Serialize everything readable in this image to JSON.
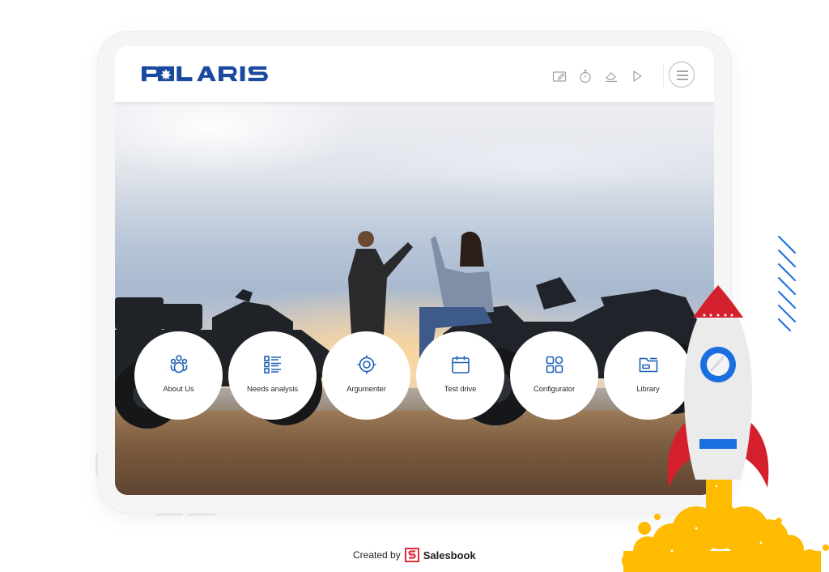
{
  "app": {
    "brand": "POLARIS",
    "brand_color": "#1a4aa0",
    "accent_color": "#1d5fb5"
  },
  "toolbar": {
    "icons": [
      {
        "name": "note-edit-icon",
        "label": "Notes"
      },
      {
        "name": "stopwatch-icon",
        "label": "Timer"
      },
      {
        "name": "eraser-icon",
        "label": "Eraser"
      },
      {
        "name": "play-icon",
        "label": "Presentation"
      }
    ],
    "menu_icon": "hamburger-menu-icon"
  },
  "hero": {
    "image_description": "Couple giving high-five between two Polaris ATVs at sunset"
  },
  "tiles": [
    {
      "label": "About Us",
      "icon": "team-icon"
    },
    {
      "label": "Needs analysis",
      "icon": "checklist-icon"
    },
    {
      "label": "Argumenter",
      "icon": "target-icon"
    },
    {
      "label": "Test drive",
      "icon": "calendar-icon"
    },
    {
      "label": "Configurator",
      "icon": "grid-icon"
    },
    {
      "label": "Library",
      "icon": "folder-icon"
    }
  ],
  "footer": {
    "created_by": "Created by",
    "brand": "Salesbook",
    "brand_color": "#e52b3a"
  },
  "decor": {
    "rocket_colors": {
      "body": "#ececed",
      "fin": "#d41f2c",
      "window": "#1a6fe0",
      "flame": "#ffbb00"
    }
  }
}
